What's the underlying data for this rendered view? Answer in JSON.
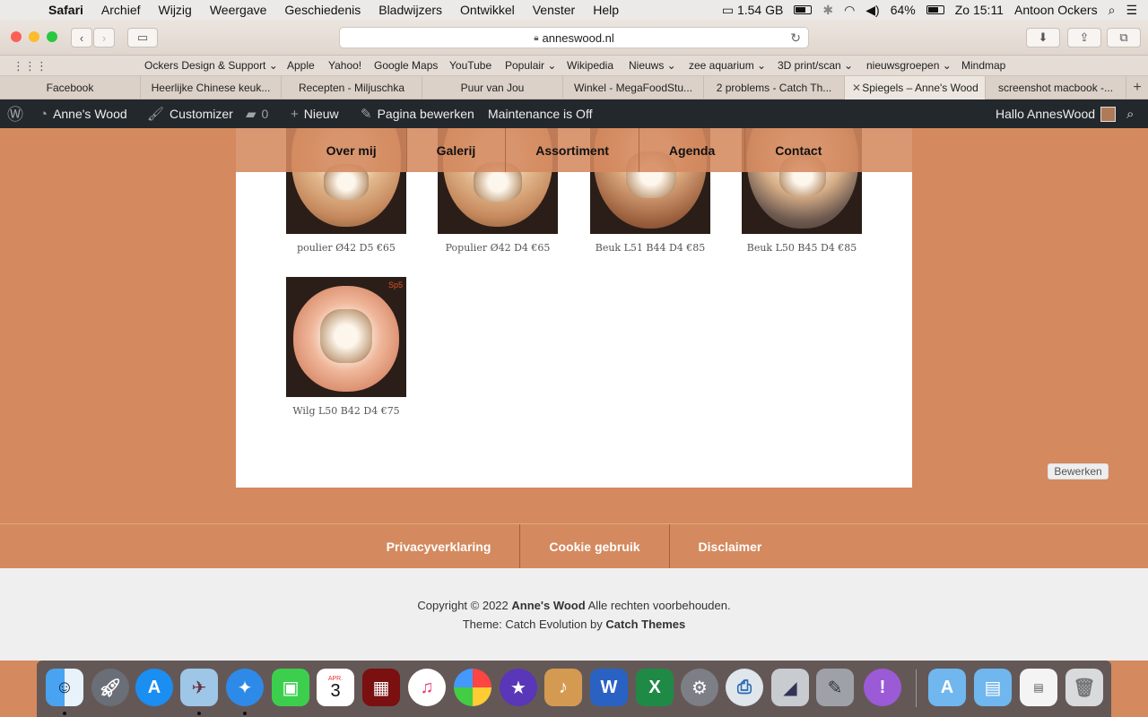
{
  "menubar": {
    "items": [
      "Safari",
      "Archief",
      "Wijzig",
      "Weergave",
      "Geschiedenis",
      "Bladwijzers",
      "Ontwikkel",
      "Venster",
      "Help"
    ],
    "memory": "1.54 GB",
    "battery": "64%",
    "clock": "Zo 15:11",
    "user": "Antoon Ockers"
  },
  "toolbar": {
    "url": "anneswood.nl"
  },
  "bookmarks": [
    "Ockers Design & Support ⌄",
    "Apple",
    "Yahoo!",
    "Google Maps",
    "YouTube",
    "Populair ⌄",
    "Wikipedia",
    "Nieuws ⌄",
    "zee aquarium ⌄",
    "3D print/scan ⌄",
    "nieuwsgroepen ⌄",
    "Mindmap"
  ],
  "tabs": [
    "Facebook",
    "Heerlijke Chinese keuk...",
    "Recepten - Miljuschka",
    "Puur van Jou",
    "Winkel - MegaFoodStu...",
    "2 problems - Catch Th...",
    "Spiegels – Anne's Wood",
    "screenshot macbook -..."
  ],
  "active_tab_index": 6,
  "wpbar": {
    "site": "Anne's Wood",
    "customizer": "Customizer",
    "comments": "0",
    "new": "Nieuw",
    "edit_page": "Pagina bewerken",
    "maintenance": "Maintenance is Off",
    "greeting": "Hallo AnnesWood"
  },
  "nav": [
    "Over mij",
    "Galerij",
    "Assortiment",
    "Agenda",
    "Contact"
  ],
  "gallery": [
    {
      "caption": "poulier Ø42 D5 €65"
    },
    {
      "caption": "Populier Ø42 D4 €65"
    },
    {
      "caption": "Beuk L51 B44 D4 €85"
    },
    {
      "caption": "Beuk L50 B45 D4 €85"
    },
    {
      "caption": "Wilg L50 B42 D4 €75",
      "badge": "Sp5"
    }
  ],
  "edit_button": "Bewerken",
  "footer_nav": [
    "Privacyverklaring",
    "Cookie gebruik",
    "Disclaimer"
  ],
  "copyright": {
    "prefix": "Copyright © 2022 ",
    "site": "Anne's Wood",
    "suffix": " Alle rechten voorbehouden.",
    "theme_prefix": "Theme: Catch Evolution by ",
    "theme_author": "Catch Themes"
  },
  "dock": {
    "calendar_month": "APR.",
    "calendar_day": "3",
    "icons": [
      "finder-icon",
      "launchpad-icon",
      "app-store-icon",
      "preview-icon",
      "safari-icon",
      "messages-icon",
      "calendar-icon",
      "photo-booth-icon",
      "itunes-icon",
      "photos-icon",
      "imovie-icon",
      "garageband-icon",
      "word-icon",
      "excel-icon",
      "system-preferences-icon",
      "printer-icon",
      "grapher-icon",
      "utility-icon",
      "feedback-icon",
      "applications-folder-icon",
      "documents-folder-icon",
      "file-icon",
      "trash-icon"
    ]
  },
  "colors": {
    "accent": "#d4895e",
    "wp_bar": "#23282d"
  }
}
